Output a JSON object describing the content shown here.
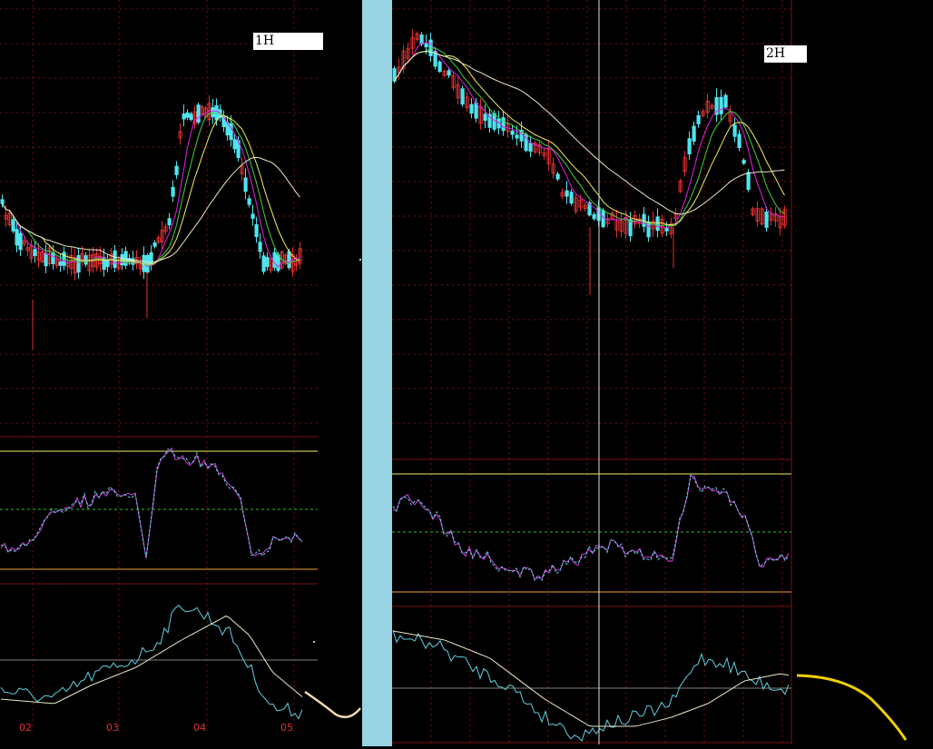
{
  "panels": {
    "left": {
      "timeframe_label": "1H",
      "x_labels": [
        "02",
        "03",
        "04",
        "05"
      ]
    },
    "right": {
      "timeframe_label": "2H"
    }
  },
  "colors": {
    "background": "#000000",
    "grid": "#7a1010",
    "bull_candle": "#e03030",
    "bear_candle": "#4ee4f0",
    "ma_white": "#e8e8c8",
    "ma_yellow": "#f0f060",
    "ma_green": "#40d040",
    "ma_magenta": "#e020e0",
    "osc_line": "#d040e0",
    "osc_dash": "#60d0e0",
    "osc_mid": "#30c030",
    "upper_band": "#f0f060",
    "lower_band": "#f0a030",
    "divider": "#98d4e4",
    "crosshair": "#e0e0e0",
    "axis_text": "#e03030",
    "projection": "#f0d000"
  }
}
